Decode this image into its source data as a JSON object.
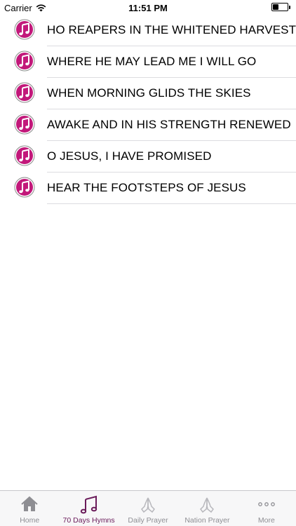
{
  "status_bar": {
    "carrier": "Carrier",
    "time": "11:51 PM",
    "battery_level": 0.35
  },
  "hymns": [
    {
      "title": "HO REAPERS IN THE WHITENED HARVEST"
    },
    {
      "title": "WHERE HE MAY LEAD ME I WILL GO"
    },
    {
      "title": "WHEN MORNING GLIDS THE SKIES"
    },
    {
      "title": "AWAKE AND IN HIS STRENGTH RENEWED"
    },
    {
      "title": "O JESUS, I HAVE PROMISED"
    },
    {
      "title": "HEAR THE FOOTSTEPS OF JESUS"
    }
  ],
  "tabs": [
    {
      "label": "Home",
      "icon": "home-icon",
      "active": false
    },
    {
      "label": "70 Days Hymns",
      "icon": "music-note-icon",
      "active": true
    },
    {
      "label": "Daily Prayer",
      "icon": "praying-hands-icon",
      "active": false
    },
    {
      "label": "Nation Prayer",
      "icon": "praying-hands-icon",
      "active": false
    },
    {
      "label": "More",
      "icon": "more-icon",
      "active": false
    }
  ],
  "colors": {
    "accent": "#6a1b5a",
    "hymn_icon": "#c2187a",
    "inactive": "#8e8e93"
  }
}
